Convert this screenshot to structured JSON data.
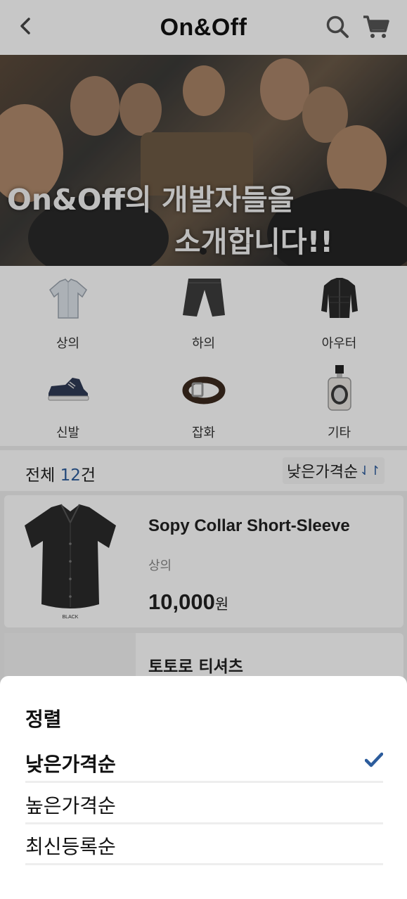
{
  "header": {
    "logo": "On&Off",
    "back_icon": "chevron-left-icon",
    "search_icon": "search-icon",
    "cart_icon": "cart-icon"
  },
  "banner": {
    "line1": "On&Off의 개발자들을",
    "line2": "소개합니다!!",
    "slide_count": 1,
    "active_slide": 1
  },
  "categories": [
    {
      "label": "상의",
      "icon": "shirt-icon"
    },
    {
      "label": "하의",
      "icon": "pants-icon"
    },
    {
      "label": "아우터",
      "icon": "jacket-icon"
    },
    {
      "label": "신발",
      "icon": "sneaker-icon"
    },
    {
      "label": "잡화",
      "icon": "belt-icon"
    },
    {
      "label": "기타",
      "icon": "perfume-icon"
    }
  ],
  "list": {
    "total_prefix": "전체 ",
    "total_count": "12",
    "total_suffix": "건",
    "sort_label": "낮은가격순",
    "sort_icon": "sort-arrows-icon"
  },
  "products": [
    {
      "name": "Sopy Collar Short-Sleeve",
      "category": "상의",
      "price": "10,000",
      "currency": "원",
      "image_caption": "BLACK"
    },
    {
      "name": "토토로 티셔츠",
      "category": "",
      "price": "",
      "currency": ""
    }
  ],
  "sort_sheet": {
    "title": "정렬",
    "options": [
      {
        "label": "낮은가격순",
        "selected": true
      },
      {
        "label": "높은가격순",
        "selected": false
      },
      {
        "label": "최신등록순",
        "selected": false
      }
    ],
    "check_color": "#2c5c9c"
  },
  "colors": {
    "accent": "#2c5c9c",
    "overlay": "rgba(0,0,0,0.22)"
  }
}
